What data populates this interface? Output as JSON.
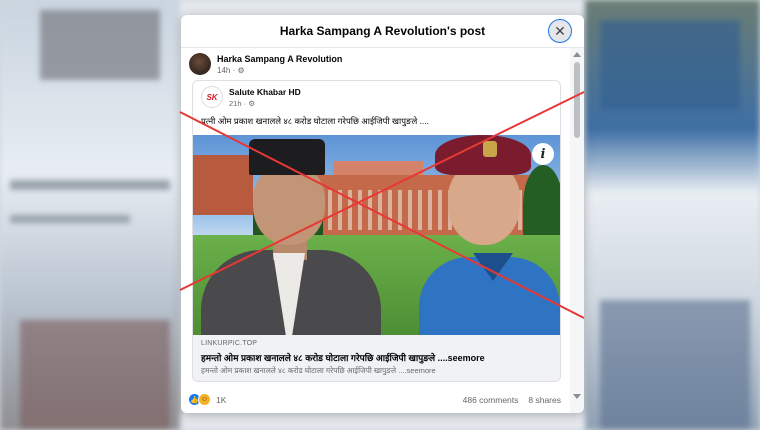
{
  "modal": {
    "title": "Harka Sampang A Revolution's post",
    "close_symbol": "✕"
  },
  "post": {
    "author": "Harka Sampang A Revolution",
    "time": "14h",
    "privacy_icon": "globe-icon"
  },
  "shared_post": {
    "page_name": "Salute Khabar HD",
    "logo_text": "SK",
    "time": "21h",
    "text": "पत्नी ओम प्रकाश खनालले ४८ करोड घोटाला गरेपछि आईजिपी खापुङले ....",
    "info_icon": "i"
  },
  "link_preview": {
    "domain": "LINKURPIC.TOP",
    "title": "हमन्तो ओम प्रकाश खनालले ४८ करोड घोटाला गरेपछि आईजिपी खापुङले ....seemore",
    "description": "हमन्तो ओम प्रकाश खनालले ४८ करोड घोटाला गरेपछि आईजिपी खापुङले ....seemore"
  },
  "footer": {
    "reactions_count": "1K",
    "comments": "486 comments",
    "shares": "8 shares"
  },
  "colors": {
    "accent": "#1877f2",
    "x_overlay": "#e53935"
  }
}
